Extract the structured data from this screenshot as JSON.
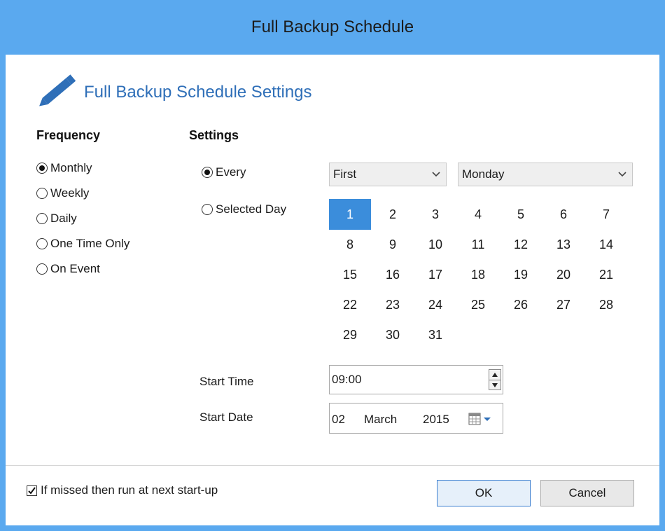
{
  "window": {
    "title": "Full Backup Schedule"
  },
  "header": {
    "title": "Full Backup Schedule Settings",
    "icon": "pencil-icon",
    "accent": "#2f6fb8"
  },
  "frequency": {
    "heading": "Frequency",
    "options": [
      {
        "label": "Monthly",
        "selected": true
      },
      {
        "label": "Weekly",
        "selected": false
      },
      {
        "label": "Daily",
        "selected": false
      },
      {
        "label": "One Time Only",
        "selected": false
      },
      {
        "label": "On Event",
        "selected": false
      }
    ]
  },
  "settings": {
    "heading": "Settings",
    "mode_every": {
      "label": "Every",
      "selected": true
    },
    "mode_selected_day": {
      "label": "Selected Day",
      "selected": false
    },
    "week_ordinal": "First",
    "weekday": "Monday",
    "calendar": {
      "days": [
        "1",
        "2",
        "3",
        "4",
        "5",
        "6",
        "7",
        "8",
        "9",
        "10",
        "11",
        "12",
        "13",
        "14",
        "15",
        "16",
        "17",
        "18",
        "19",
        "20",
        "21",
        "22",
        "23",
        "24",
        "25",
        "26",
        "27",
        "28",
        "29",
        "30",
        "31"
      ],
      "selected_day": "1",
      "selected_color": "#3b8ddb"
    },
    "start_time": {
      "label": "Start Time",
      "value": "09:00"
    },
    "start_date": {
      "label": "Start Date",
      "day": "02",
      "month": "March",
      "year": "2015"
    }
  },
  "footer": {
    "missed_checkbox": {
      "label": "If missed then run at next start-up",
      "checked": true
    },
    "ok_label": "OK",
    "cancel_label": "Cancel"
  }
}
